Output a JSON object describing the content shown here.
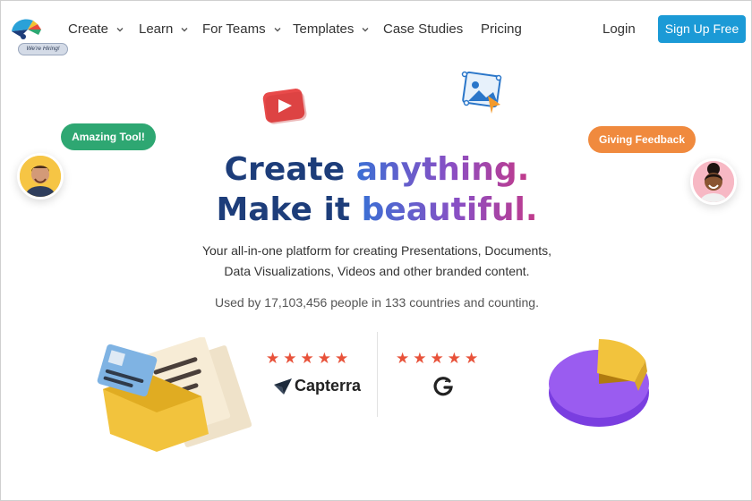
{
  "nav": {
    "hiring_badge": "We're Hiring!",
    "items": [
      {
        "label": "Create",
        "has_dropdown": true
      },
      {
        "label": "Learn",
        "has_dropdown": true
      },
      {
        "label": "For Teams",
        "has_dropdown": true
      },
      {
        "label": "Templates",
        "has_dropdown": true
      },
      {
        "label": "Case Studies",
        "has_dropdown": false
      },
      {
        "label": "Pricing",
        "has_dropdown": false
      }
    ],
    "login": "Login",
    "signup": "Sign Up Free"
  },
  "hero": {
    "line1_a": "Create",
    "line1_b": "anything.",
    "line2_a": "Make it",
    "line2_b": "beautiful.",
    "sub_line1": "Your all-in-one platform for creating Presentations, Documents,",
    "sub_line2": "Data Visualizations, Videos and other branded content.",
    "used_by": "Used by 17,103,456 people in 133 countries and counting."
  },
  "bubbles": {
    "left": "Amazing Tool!",
    "right": "Giving Feedback"
  },
  "ratings": {
    "capterra_stars": "★★★★★",
    "capterra_label": "Capterra",
    "g2_stars": "★★★★★",
    "g2_label": "G2"
  },
  "colors": {
    "accent": "#1b9ad6",
    "headline_dark": "#1d3d7a",
    "bubble_green": "#2ea772",
    "bubble_orange": "#f08a3e",
    "star": "#e8523a"
  }
}
